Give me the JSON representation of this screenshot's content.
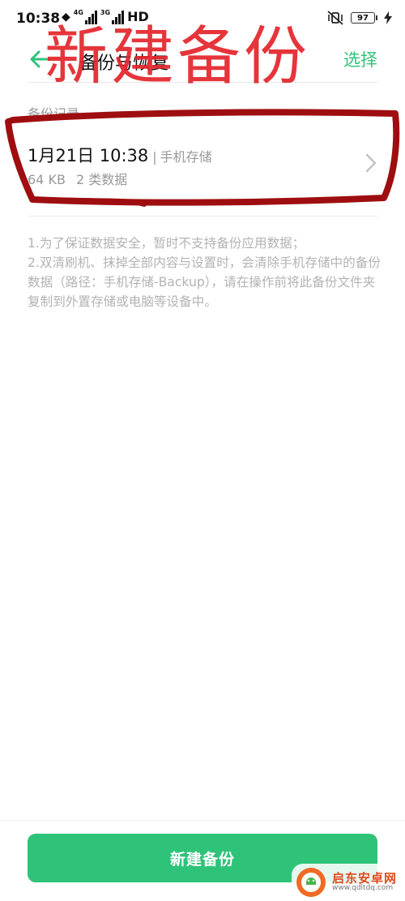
{
  "status_bar": {
    "time": "10:38",
    "network_1": "4G",
    "network_2": "3G",
    "hd": "HD",
    "battery": "97"
  },
  "header": {
    "title": "备份与恢复",
    "select_label": "选择"
  },
  "annotation": {
    "text": "新建备份",
    "color": "#e3242b"
  },
  "section": {
    "label": "备份记录"
  },
  "backup_records": [
    {
      "date": "1月21日 10:38",
      "separator": "|",
      "location": "手机存储",
      "size": "64 KB",
      "count": "2 类数据"
    }
  ],
  "notes": [
    "1.为了保证数据安全，暂时不支持备份应用数据；",
    "2.双清刷机、抹掉全部内容与设置时，会清除手机存储中的备份数据（路径：手机存储-Backup），请在操作前将此备份文件夹复制到外置存储或电脑等设备中。"
  ],
  "bottom": {
    "new_backup_label": "新建备份"
  },
  "watermark": {
    "name": "启东安卓网",
    "url": "www.qdltdq.com"
  },
  "colors": {
    "accent": "#2fc37a",
    "annotation": "#e3242b",
    "annotation_frame": "#9e0e10"
  }
}
